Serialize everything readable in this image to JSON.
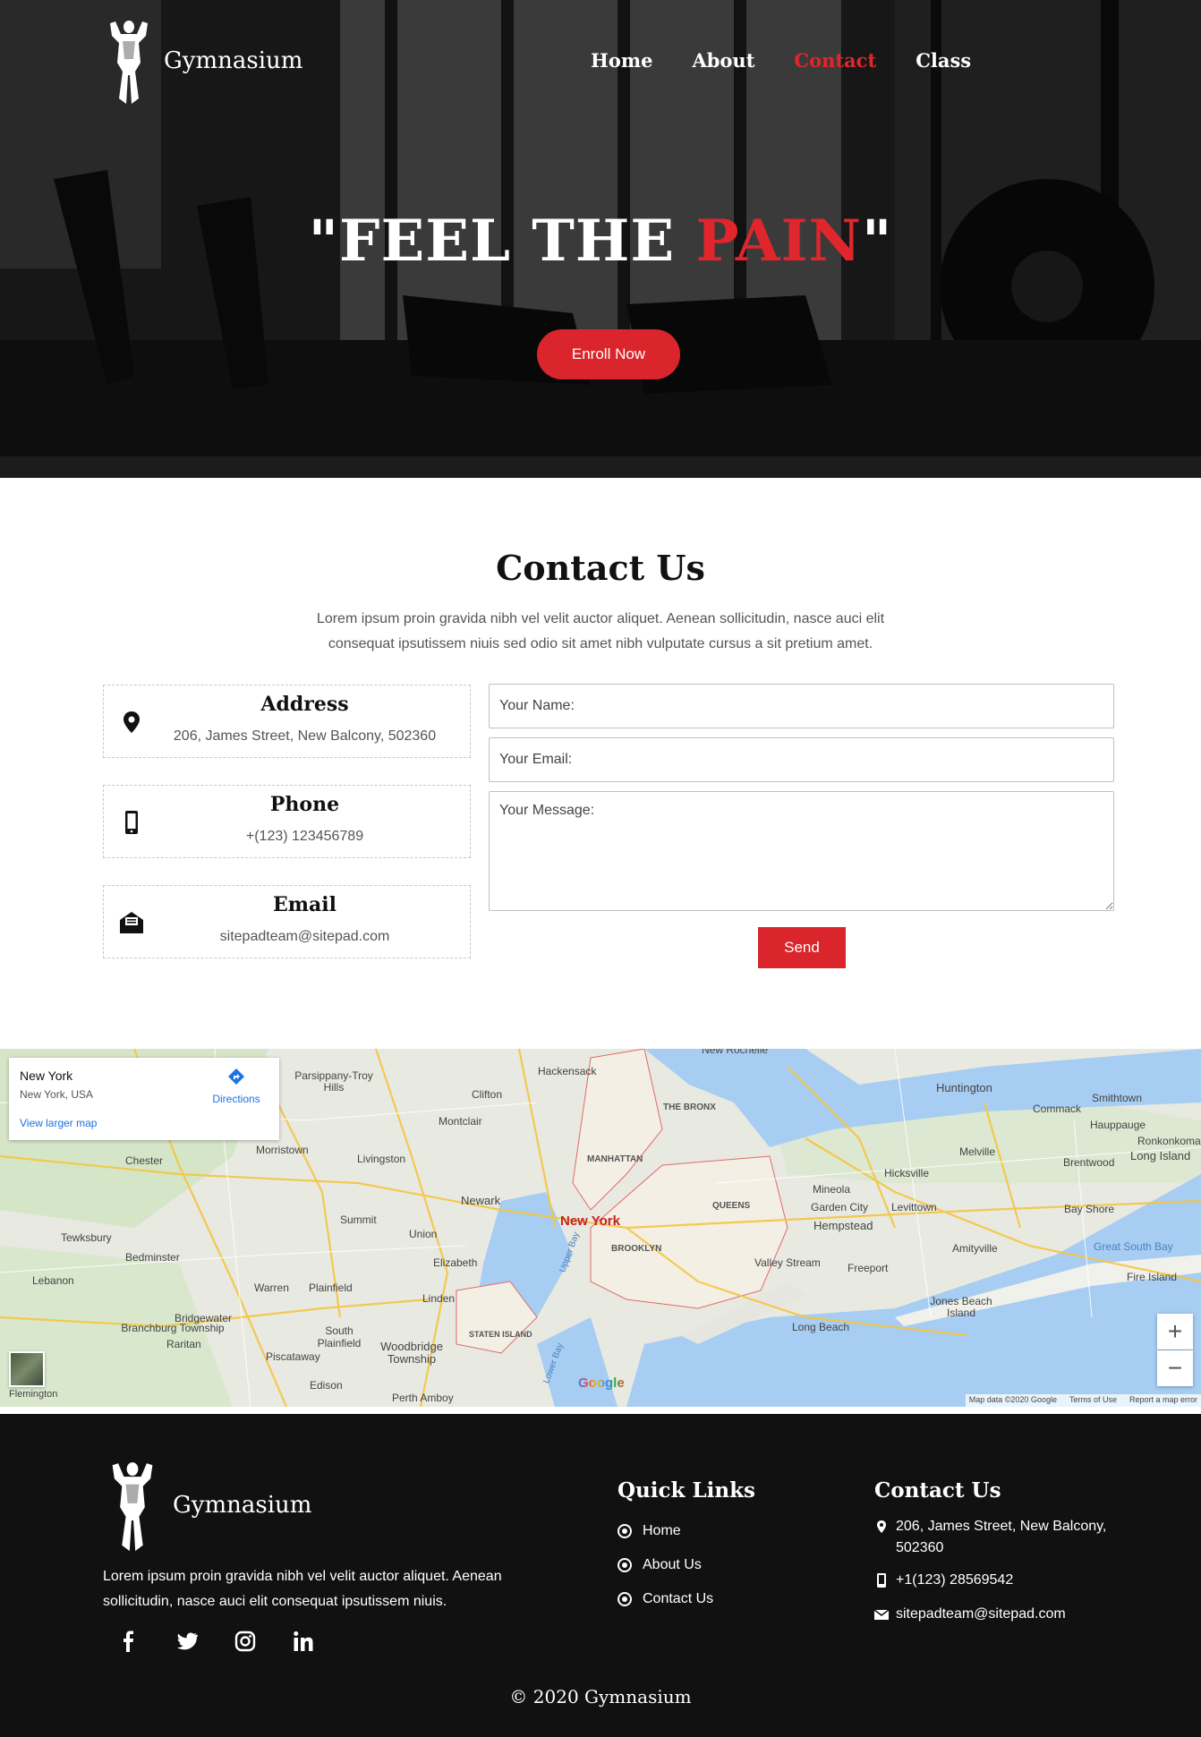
{
  "brand": {
    "name": "Gymnasium"
  },
  "nav": {
    "items": [
      "Home",
      "About",
      "Contact",
      "Class"
    ],
    "active": "Contact"
  },
  "hero": {
    "headline_open": "\"FEEL THE ",
    "headline_accent": "PAIN",
    "headline_close": "\"",
    "cta": "Enroll Now"
  },
  "contact": {
    "title": "Contact Us",
    "description": "Lorem ipsum proin gravida nibh vel velit auctor aliquet. Aenean sollicitudin, nasce auci elit consequat ipsutissem niuis sed odio sit amet nibh vulputate cursus a sit pretium amet.",
    "cards": [
      {
        "title": "Address",
        "value": "206, James Street, New Balcony, 502360",
        "icon": "map-pin-icon"
      },
      {
        "title": "Phone",
        "value": "+(123) 123456789",
        "icon": "phone-icon"
      },
      {
        "title": "Email",
        "value": "sitepadteam@sitepad.com",
        "icon": "email-icon"
      }
    ],
    "form": {
      "name_placeholder": "Your Name:",
      "email_placeholder": "Your Email:",
      "message_placeholder": "Your Message:",
      "send": "Send"
    }
  },
  "map": {
    "place": "New York",
    "address": "New York, USA",
    "directions": "Directions",
    "larger": "View larger map",
    "attribution": [
      "Map data ©2020 Google",
      "Terms of Use",
      "Report a map error"
    ],
    "google": "Google",
    "labels": [
      "New York",
      "Newark",
      "Clifton",
      "Hackensack",
      "Montclair",
      "Morristown",
      "Livingston",
      "Summit",
      "Union",
      "Elizabeth",
      "Chester",
      "Tewksbury",
      "Bedminster",
      "Warren",
      "Plainfield",
      "Linden",
      "Bridgewater",
      "Branchburg Township",
      "Raritan",
      "South Plainfield",
      "Piscataway",
      "Woodbridge Township",
      "Edison",
      "Perth Amboy",
      "Flemington",
      "Lebanon",
      "MANHATTAN",
      "BROOKLYN",
      "QUEENS",
      "THE BRONX",
      "STATEN ISLAND",
      "New Rochelle",
      "Huntington",
      "Commack",
      "Smithtown",
      "Hauppauge",
      "Ronkonkoma",
      "Melville",
      "Hicksville",
      "Brentwood",
      "Long Island",
      "Mineola",
      "Garden City",
      "Hempstead",
      "Levittown",
      "Bay Shore",
      "Amityville",
      "Valley Stream",
      "Freeport",
      "Great South Bay",
      "Fire Island",
      "Jones Beach Island",
      "Long Beach",
      "Parsippany-Troy Hills",
      "Upper Bay",
      "Lower Bay"
    ]
  },
  "footer": {
    "brand": "Gymnasium",
    "description": "Lorem ipsum proin gravida nibh vel velit auctor aliquet. Aenean sollicitudin, nasce auci elit consequat ipsutissem niuis.",
    "socials": [
      "facebook-icon",
      "twitter-icon",
      "instagram-icon",
      "linkedin-icon"
    ],
    "quick_links_title": "Quick Links",
    "quick_links": [
      "Home",
      "About Us",
      "Contact Us"
    ],
    "contact_title": "Contact Us",
    "address": "206, James Street, New Balcony, 502360",
    "phone": "+1(123) 28569542",
    "email": "sitepadteam@sitepad.com",
    "copyright": "© 2020 Gymnasium"
  },
  "colors": {
    "accent": "#d9252b",
    "footer_bg": "#111111"
  }
}
